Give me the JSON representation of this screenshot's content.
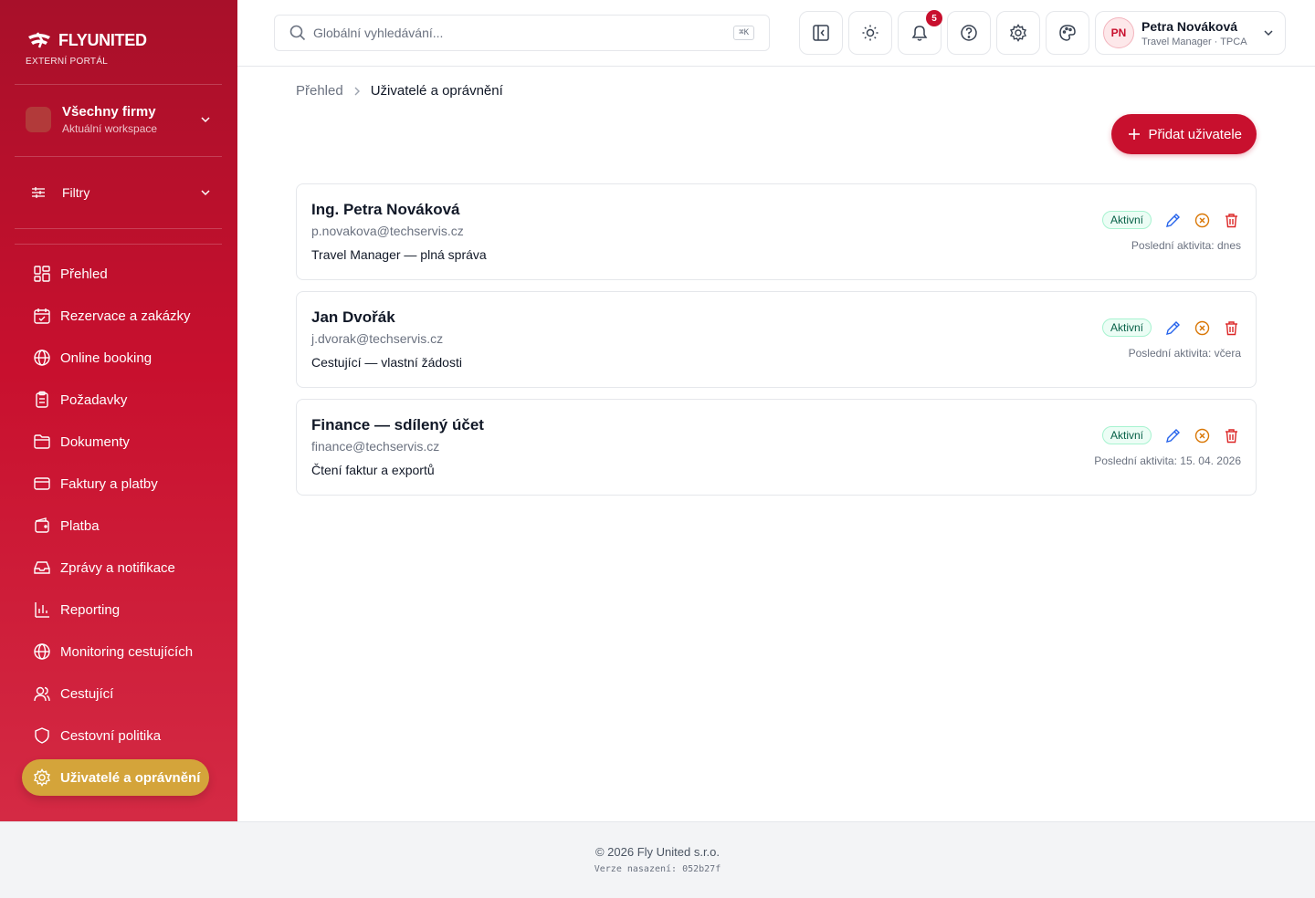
{
  "brand": {
    "name": "FLYUNITED",
    "subtitle": "EXTERNÍ PORTÁL",
    "accent": "#c8102e",
    "active_nav": "#d4a43a"
  },
  "workspace": {
    "title": "Všechny firmy",
    "subtitle": "Aktuální workspace"
  },
  "filters": {
    "label": "Filtry"
  },
  "nav": [
    {
      "label": "Přehled",
      "icon": "dashboard-icon"
    },
    {
      "label": "Rezervace a zakázky",
      "icon": "calendar-check-icon"
    },
    {
      "label": "Online booking",
      "icon": "globe-icon"
    },
    {
      "label": "Požadavky",
      "icon": "clipboard-icon"
    },
    {
      "label": "Dokumenty",
      "icon": "folder-icon"
    },
    {
      "label": "Faktury a platby",
      "icon": "credit-card-icon"
    },
    {
      "label": "Platba",
      "icon": "wallet-icon"
    },
    {
      "label": "Zprávy a notifikace",
      "icon": "inbox-icon"
    },
    {
      "label": "Reporting",
      "icon": "bar-chart-icon"
    },
    {
      "label": "Monitoring cestujících",
      "icon": "globe-icon"
    },
    {
      "label": "Cestující",
      "icon": "users-icon"
    },
    {
      "label": "Cestovní politika",
      "icon": "shield-icon"
    },
    {
      "label": "Uživatelé a oprávnění",
      "icon": "gear-icon",
      "active": true
    }
  ],
  "search": {
    "placeholder": "Globální vyhledávání...",
    "shortcut": "⌘K"
  },
  "notifications": {
    "count": "5"
  },
  "user": {
    "initials": "PN",
    "name": "Petra Nováková",
    "role": "Travel Manager · TPCA"
  },
  "breadcrumb": {
    "home": "Přehled",
    "current": "Uživatelé a oprávnění"
  },
  "add_button": {
    "label": "Přidat uživatele"
  },
  "users": [
    {
      "name": "Ing. Petra Nováková",
      "email": "p.novakova@techservis.cz",
      "role": "Travel Manager — plná správa",
      "status": "Aktivní",
      "activity": "Poslední aktivita: dnes"
    },
    {
      "name": "Jan Dvořák",
      "email": "j.dvorak@techservis.cz",
      "role": "Cestující — vlastní žádosti",
      "status": "Aktivní",
      "activity": "Poslední aktivita: včera"
    },
    {
      "name": "Finance — sdílený účet",
      "email": "finance@techservis.cz",
      "role": "Čtení faktur a exportů",
      "status": "Aktivní",
      "activity": "Poslední aktivita: 15. 04. 2026"
    }
  ],
  "footer": {
    "copyright": "© 2026 Fly United s.r.o.",
    "version": "Verze nasazení: 052b27f"
  }
}
